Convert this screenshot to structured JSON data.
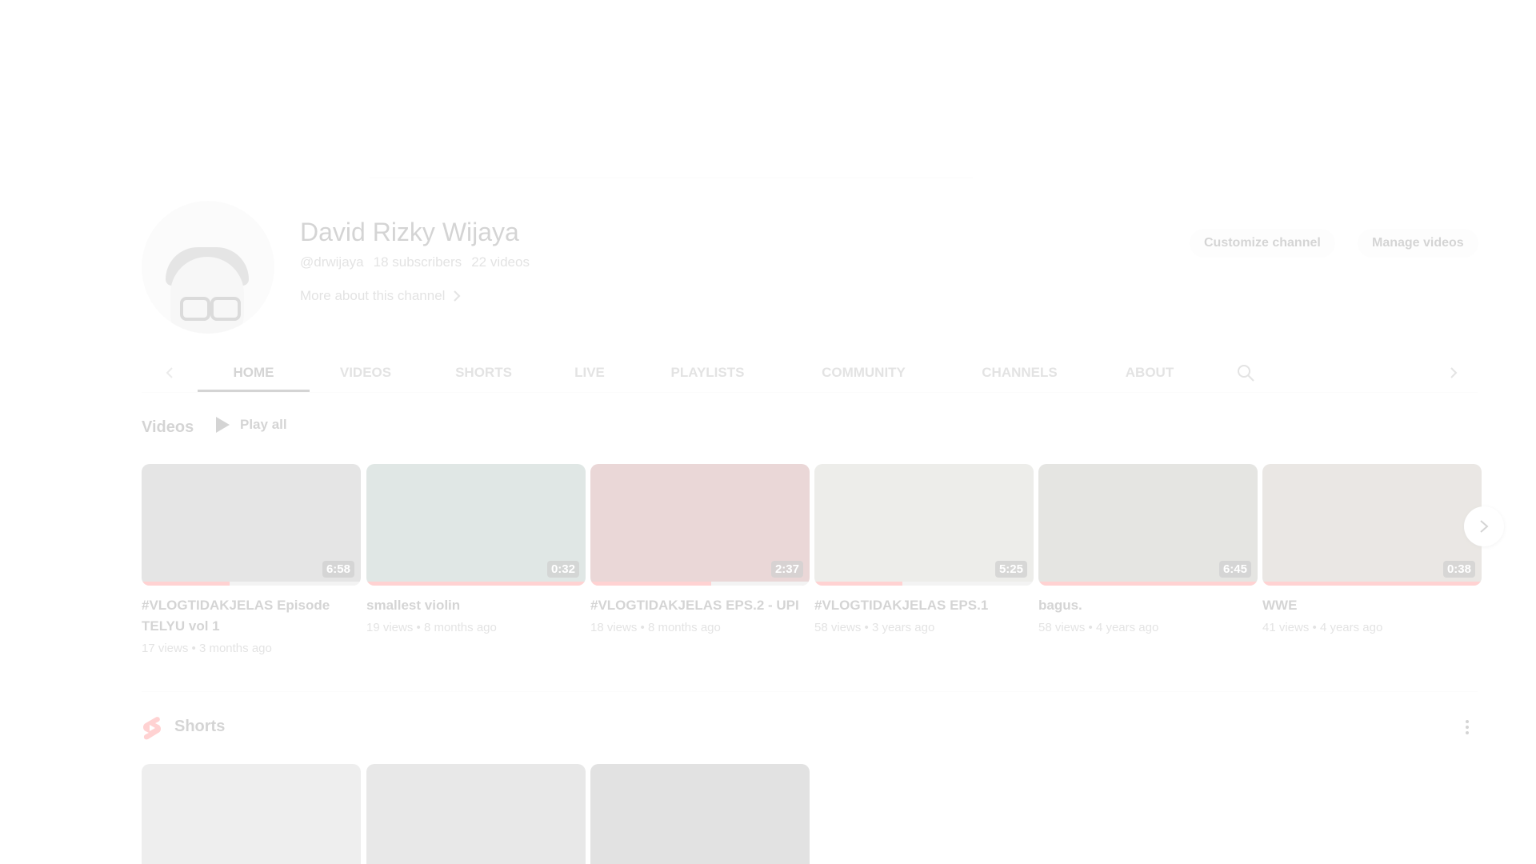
{
  "channel": {
    "name": "David Rizky Wijaya",
    "handle": "@drwijaya",
    "subscribers": "18 subscribers",
    "videos_count": "22 videos",
    "more_about": "More about this channel"
  },
  "actions": {
    "customize": "Customize channel",
    "manage": "Manage videos"
  },
  "tabs": [
    {
      "label": "HOME",
      "active": true
    },
    {
      "label": "VIDEOS"
    },
    {
      "label": "SHORTS"
    },
    {
      "label": "LIVE"
    },
    {
      "label": "PLAYLISTS"
    },
    {
      "label": "COMMUNITY"
    },
    {
      "label": "CHANNELS"
    },
    {
      "label": "ABOUT"
    }
  ],
  "videos_section": {
    "title": "Videos",
    "play_all": "Play all",
    "items": [
      {
        "title": "#VLOGTIDAKJELAS Episode TELYU vol 1",
        "meta": "17 views • 3 months ago",
        "duration": "6:58",
        "progress": 0.4,
        "color": "#6b6b6b"
      },
      {
        "title": "smallest violin",
        "meta": "19 views • 8 months ago",
        "duration": "0:32",
        "progress": 1.0,
        "color": "#4f7a6c"
      },
      {
        "title": "#VLOGTIDAKJELAS EPS.2 - UPI",
        "meta": "18 views • 8 months ago",
        "duration": "2:37",
        "progress": 0.55,
        "color": "#8a1d1d"
      },
      {
        "title": "#VLOGTIDAKJELAS EPS.1",
        "meta": "58 views • 3 years ago",
        "duration": "5:25",
        "progress": 0.4,
        "color": "#9a9a86"
      },
      {
        "title": "bagus.",
        "meta": "58 views • 4 years ago",
        "duration": "6:45",
        "progress": 1.0,
        "color": "#6e6a5e"
      },
      {
        "title": "WWE",
        "meta": "41 views • 4 years ago",
        "duration": "0:38",
        "progress": 1.0,
        "color": "#8a7a66"
      }
    ]
  },
  "shorts_section": {
    "title": "Shorts",
    "items": [
      {
        "color": "#9e9e9e"
      },
      {
        "color": "#7d7d7d"
      },
      {
        "color": "#5a5a5a"
      }
    ]
  },
  "icons": {
    "scroll_left": "chevron-left-icon",
    "scroll_right": "chevron-right-icon",
    "search": "search-icon",
    "play": "play-icon",
    "shorts": "shorts-icon",
    "more": "more-vert-icon"
  }
}
